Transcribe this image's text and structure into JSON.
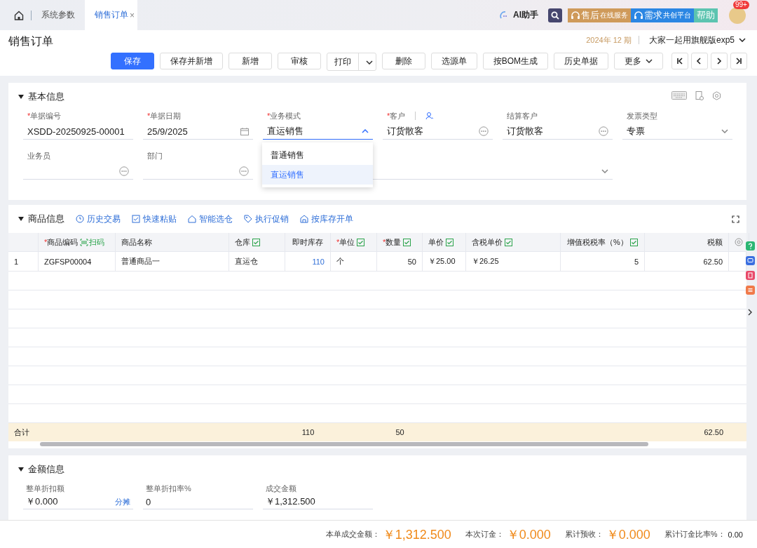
{
  "top_bar": {
    "tabs": [
      {
        "label": "系统参数",
        "selected": false
      },
      {
        "label": "销售订单",
        "selected": true,
        "close": "×"
      }
    ],
    "assistant": "AI助手",
    "service_buttons": [
      {
        "main": "售后",
        "sub": "在线服务",
        "color": "#cf9a5a"
      },
      {
        "main": "需求",
        "sub": "共创平台",
        "color": "#2b86e3"
      },
      {
        "main": "帮助",
        "color": "#5cc4b0"
      }
    ],
    "badge": "99+"
  },
  "header": {
    "title": "销售订单",
    "period": "2024年 12 期",
    "account": "大家一起用旗舰版exp5"
  },
  "toolbar": [
    {
      "label": "保存",
      "kind": "primary"
    },
    {
      "label": "保存并新增",
      "kind": "plain"
    },
    {
      "label": "新增",
      "kind": "plain"
    },
    {
      "label": "审核",
      "kind": "plain"
    },
    {
      "label": "打印",
      "kind": "split"
    },
    {
      "label": "删除",
      "kind": "plain"
    },
    {
      "label": "选源单",
      "kind": "plain"
    },
    {
      "label": "按BOM生成",
      "kind": "plain"
    },
    {
      "label": "历史单据",
      "kind": "plain"
    },
    {
      "label": "更多",
      "kind": "menu"
    }
  ],
  "basic_info": {
    "title": "基本信息",
    "expanded": true,
    "fields": [
      {
        "label": "单据编号",
        "required_mark": "*",
        "value": "XSDD-20250925-00001",
        "kind": "text"
      },
      {
        "label": "单据日期",
        "required_mark": "*",
        "value": "25/9/2025",
        "kind": "date"
      },
      {
        "label": "业务模式",
        "required_mark": "*",
        "value": "直运销售",
        "kind": "select",
        "open": true,
        "options": [
          {
            "label": "普通销售",
            "selected": false
          },
          {
            "label": "直运销售",
            "selected": true
          }
        ]
      },
      {
        "label": "客户",
        "required_mark": "*",
        "value": "订货散客",
        "kind": "lookup",
        "contact_icon": true
      },
      {
        "label": "结算客户",
        "value": "订货散客",
        "kind": "lookup"
      },
      {
        "label": "发票类型",
        "value": "专票",
        "kind": "select",
        "open": false
      },
      {
        "label": "业务员",
        "kind": "lookup"
      },
      {
        "label": "部门",
        "kind": "lookup"
      },
      {
        "kind": "select",
        "open": false,
        "wide": true
      }
    ]
  },
  "goods": {
    "title": "商品信息",
    "expanded": true,
    "tools": [
      {
        "label": "历史交易",
        "kind": "clock"
      },
      {
        "label": "快速粘贴",
        "kind": "check"
      },
      {
        "label": "智能选仓",
        "kind": "house"
      },
      {
        "label": "执行促销",
        "kind": "tag"
      },
      {
        "label": "按库存开单",
        "kind": "store"
      }
    ],
    "table": {
      "columns": [
        {
          "label": "商品编码",
          "required_mark": "*",
          "scan": "扫码"
        },
        {
          "label": "商品名称"
        },
        {
          "label": "仓库",
          "batch": true
        },
        {
          "label": "即时库存"
        },
        {
          "label": "单位",
          "required_mark": "*",
          "batch": true
        },
        {
          "label": "数量",
          "required_mark": "*",
          "batch": true
        },
        {
          "label": "单价",
          "batch": true
        },
        {
          "label": "含税单价",
          "batch": true
        },
        {
          "label": "增值税税率（%）",
          "batch": true
        },
        {
          "label": "税额"
        }
      ],
      "rows": [
        {
          "index": "1",
          "cells": [
            "ZGFSP00004",
            "普通商品一",
            "直运仓",
            "110",
            "个",
            "50",
            "￥25.00",
            "￥26.25",
            "5",
            "62.50"
          ]
        }
      ],
      "totals": {
        "label": "合计",
        "cells": [
          null,
          null,
          null,
          "110",
          null,
          "50",
          null,
          null,
          null,
          "62.50"
        ]
      }
    }
  },
  "amount_info": {
    "title": "金额信息",
    "expanded": true,
    "fields": [
      {
        "label": "整单折扣额",
        "value": "￥0.000",
        "action": "分摊"
      },
      {
        "label": "整单折扣率%",
        "value": "0"
      },
      {
        "label": "成交金额",
        "value": "￥1,312.500"
      }
    ]
  },
  "footer": [
    {
      "label": "本单成交金额：",
      "value": "￥1,312.500",
      "kind": "large"
    },
    {
      "label": "本次订金：",
      "value": "￥0.000",
      "kind": "large"
    },
    {
      "label": "累计预收：",
      "value": "￥0.000",
      "kind": "large"
    },
    {
      "label": "累计订金比率%：",
      "value": "0.00",
      "kind": "small"
    }
  ]
}
